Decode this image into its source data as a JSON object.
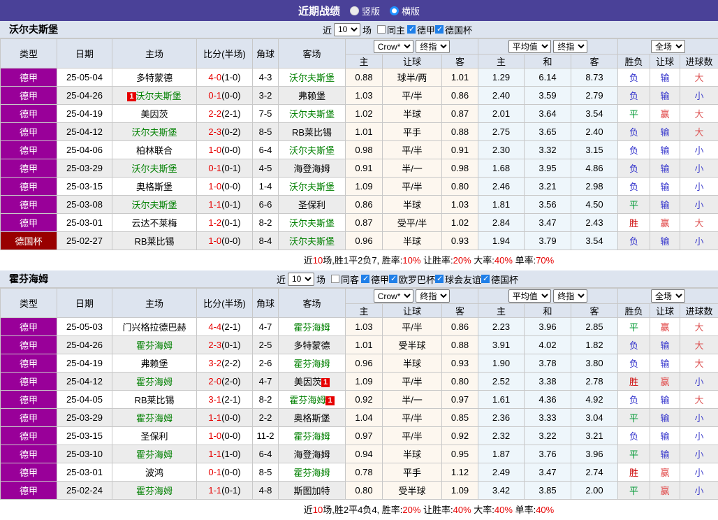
{
  "header": {
    "title": "近期战绩",
    "radio_vertical": "竖版",
    "radio_horizontal": "横版"
  },
  "table_head": {
    "type": "类型",
    "date": "日期",
    "home": "主场",
    "score": "比分(半场)",
    "corner": "角球",
    "away": "客场",
    "odds_select1": "Crow*",
    "odds_select2": "终指",
    "odds_cols": [
      "主",
      "让球",
      "客"
    ],
    "avg_select1": "平均值",
    "avg_select2": "终指",
    "avg_cols": [
      "主",
      "和",
      "客"
    ],
    "full_select": "全场",
    "full_cols": [
      "胜负",
      "让球",
      "进球数"
    ]
  },
  "colors": {
    "topbar": "#4a4198",
    "competition": {
      "德甲": "#990099",
      "德国杯": "#990000"
    },
    "highlight_team": "#008000",
    "score": "#e60000",
    "badge_bg": "#e60000",
    "values": {
      "胜": "#cc0000",
      "赢": "#e04444",
      "大": "#dd5555",
      "平": "#009933",
      "负": "#3333cc",
      "输": "#3333cc",
      "小": "#4444cc"
    }
  },
  "sections": [
    {
      "team": "沃尔夫斯堡",
      "filter": {
        "near": "近",
        "count": "10",
        "games": "场",
        "same": {
          "label": "同主",
          "checked": false
        },
        "leagues": [
          {
            "label": "德甲",
            "checked": true
          },
          {
            "label": "德国杯",
            "checked": true
          }
        ]
      },
      "rows": [
        {
          "competition": "德甲",
          "date": "25-05-04",
          "home": {
            "name": "多特蒙德"
          },
          "score": "4-0",
          "half": "(1-0)",
          "corner": "4-3",
          "away": {
            "name": "沃尔夫斯堡",
            "hl": true
          },
          "odds": [
            "0.88",
            "球半/两",
            "1.01"
          ],
          "avg": [
            "1.29",
            "6.14",
            "8.73"
          ],
          "result": [
            "负",
            "输",
            "大"
          ]
        },
        {
          "competition": "德甲",
          "date": "25-04-26",
          "home": {
            "name": "沃尔夫斯堡",
            "hl": true,
            "badge_before": "1"
          },
          "score": "0-1",
          "half": "(0-0)",
          "corner": "3-2",
          "away": {
            "name": "弗赖堡"
          },
          "odds": [
            "1.03",
            "平/半",
            "0.86"
          ],
          "avg": [
            "2.40",
            "3.59",
            "2.79"
          ],
          "result": [
            "负",
            "输",
            "小"
          ]
        },
        {
          "competition": "德甲",
          "date": "25-04-19",
          "home": {
            "name": "美因茨"
          },
          "score": "2-2",
          "half": "(2-1)",
          "corner": "7-5",
          "away": {
            "name": "沃尔夫斯堡",
            "hl": true
          },
          "odds": [
            "1.02",
            "半球",
            "0.87"
          ],
          "avg": [
            "2.01",
            "3.64",
            "3.54"
          ],
          "result": [
            "平",
            "赢",
            "大"
          ]
        },
        {
          "competition": "德甲",
          "date": "25-04-12",
          "home": {
            "name": "沃尔夫斯堡",
            "hl": true
          },
          "score": "2-3",
          "half": "(0-2)",
          "corner": "8-5",
          "away": {
            "name": "RB莱比锡"
          },
          "odds": [
            "1.01",
            "平手",
            "0.88"
          ],
          "avg": [
            "2.75",
            "3.65",
            "2.40"
          ],
          "result": [
            "负",
            "输",
            "大"
          ]
        },
        {
          "competition": "德甲",
          "date": "25-04-06",
          "home": {
            "name": "柏林联合"
          },
          "score": "1-0",
          "half": "(0-0)",
          "corner": "6-4",
          "away": {
            "name": "沃尔夫斯堡",
            "hl": true
          },
          "odds": [
            "0.98",
            "平/半",
            "0.91"
          ],
          "avg": [
            "2.30",
            "3.32",
            "3.15"
          ],
          "result": [
            "负",
            "输",
            "小"
          ]
        },
        {
          "competition": "德甲",
          "date": "25-03-29",
          "home": {
            "name": "沃尔夫斯堡",
            "hl": true
          },
          "score": "0-1",
          "half": "(0-1)",
          "corner": "4-5",
          "away": {
            "name": "海登海姆"
          },
          "odds": [
            "0.91",
            "半/一",
            "0.98"
          ],
          "avg": [
            "1.68",
            "3.95",
            "4.86"
          ],
          "result": [
            "负",
            "输",
            "小"
          ]
        },
        {
          "competition": "德甲",
          "date": "25-03-15",
          "home": {
            "name": "奥格斯堡"
          },
          "score": "1-0",
          "half": "(0-0)",
          "corner": "1-4",
          "away": {
            "name": "沃尔夫斯堡",
            "hl": true
          },
          "odds": [
            "1.09",
            "平/半",
            "0.80"
          ],
          "avg": [
            "2.46",
            "3.21",
            "2.98"
          ],
          "result": [
            "负",
            "输",
            "小"
          ]
        },
        {
          "competition": "德甲",
          "date": "25-03-08",
          "home": {
            "name": "沃尔夫斯堡",
            "hl": true
          },
          "score": "1-1",
          "half": "(0-1)",
          "corner": "6-6",
          "away": {
            "name": "圣保利"
          },
          "odds": [
            "0.86",
            "半球",
            "1.03"
          ],
          "avg": [
            "1.81",
            "3.56",
            "4.50"
          ],
          "result": [
            "平",
            "输",
            "小"
          ]
        },
        {
          "competition": "德甲",
          "date": "25-03-01",
          "home": {
            "name": "云达不莱梅"
          },
          "score": "1-2",
          "half": "(0-1)",
          "corner": "8-2",
          "away": {
            "name": "沃尔夫斯堡",
            "hl": true
          },
          "odds": [
            "0.87",
            "受平/半",
            "1.02"
          ],
          "avg": [
            "2.84",
            "3.47",
            "2.43"
          ],
          "result": [
            "胜",
            "赢",
            "大"
          ]
        },
        {
          "competition": "德国杯",
          "date": "25-02-27",
          "home": {
            "name": "RB莱比锡"
          },
          "score": "1-0",
          "half": "(0-0)",
          "corner": "8-4",
          "away": {
            "name": "沃尔夫斯堡",
            "hl": true
          },
          "odds": [
            "0.96",
            "半球",
            "0.93"
          ],
          "avg": [
            "1.94",
            "3.79",
            "3.54"
          ],
          "result": [
            "负",
            "输",
            "小"
          ]
        }
      ],
      "summary": [
        {
          "t": "近",
          "red": false
        },
        {
          "t": "10",
          "red": true
        },
        {
          "t": "场,胜1平2负7, 胜率:",
          "red": false
        },
        {
          "t": "10%",
          "red": true
        },
        {
          "t": " 让胜率:",
          "red": false
        },
        {
          "t": "20%",
          "red": true
        },
        {
          "t": " 大率:",
          "red": false
        },
        {
          "t": "40%",
          "red": true
        },
        {
          "t": " 单率:",
          "red": false
        },
        {
          "t": "70%",
          "red": true
        }
      ]
    },
    {
      "team": "霍芬海姆",
      "filter": {
        "near": "近",
        "count": "10",
        "games": "场",
        "same": {
          "label": "同客",
          "checked": false
        },
        "leagues": [
          {
            "label": "德甲",
            "checked": true
          },
          {
            "label": "欧罗巴杯",
            "checked": true
          },
          {
            "label": "球会友谊",
            "checked": true
          },
          {
            "label": "德国杯",
            "checked": true
          }
        ]
      },
      "rows": [
        {
          "competition": "德甲",
          "date": "25-05-03",
          "home": {
            "name": "门兴格拉德巴赫"
          },
          "score": "4-4",
          "half": "(2-1)",
          "corner": "4-7",
          "away": {
            "name": "霍芬海姆",
            "hl": true
          },
          "odds": [
            "1.03",
            "平/半",
            "0.86"
          ],
          "avg": [
            "2.23",
            "3.96",
            "2.85"
          ],
          "result": [
            "平",
            "赢",
            "大"
          ]
        },
        {
          "competition": "德甲",
          "date": "25-04-26",
          "home": {
            "name": "霍芬海姆",
            "hl": true
          },
          "score": "2-3",
          "half": "(0-1)",
          "corner": "2-5",
          "away": {
            "name": "多特蒙德"
          },
          "odds": [
            "1.01",
            "受半球",
            "0.88"
          ],
          "avg": [
            "3.91",
            "4.02",
            "1.82"
          ],
          "result": [
            "负",
            "输",
            "大"
          ]
        },
        {
          "competition": "德甲",
          "date": "25-04-19",
          "home": {
            "name": "弗赖堡"
          },
          "score": "3-2",
          "half": "(2-2)",
          "corner": "2-6",
          "away": {
            "name": "霍芬海姆",
            "hl": true
          },
          "odds": [
            "0.96",
            "半球",
            "0.93"
          ],
          "avg": [
            "1.90",
            "3.78",
            "3.80"
          ],
          "result": [
            "负",
            "输",
            "大"
          ]
        },
        {
          "competition": "德甲",
          "date": "25-04-12",
          "home": {
            "name": "霍芬海姆",
            "hl": true
          },
          "score": "2-0",
          "half": "(2-0)",
          "corner": "4-7",
          "away": {
            "name": "美因茨",
            "badge_after": "1"
          },
          "odds": [
            "1.09",
            "平/半",
            "0.80"
          ],
          "avg": [
            "2.52",
            "3.38",
            "2.78"
          ],
          "result": [
            "胜",
            "赢",
            "小"
          ]
        },
        {
          "competition": "德甲",
          "date": "25-04-05",
          "home": {
            "name": "RB莱比锡"
          },
          "score": "3-1",
          "half": "(2-1)",
          "corner": "8-2",
          "away": {
            "name": "霍芬海姆",
            "hl": true,
            "badge_after": "1"
          },
          "odds": [
            "0.92",
            "半/一",
            "0.97"
          ],
          "avg": [
            "1.61",
            "4.36",
            "4.92"
          ],
          "result": [
            "负",
            "输",
            "大"
          ]
        },
        {
          "competition": "德甲",
          "date": "25-03-29",
          "home": {
            "name": "霍芬海姆",
            "hl": true
          },
          "score": "1-1",
          "half": "(0-0)",
          "corner": "2-2",
          "away": {
            "name": "奥格斯堡"
          },
          "odds": [
            "1.04",
            "平/半",
            "0.85"
          ],
          "avg": [
            "2.36",
            "3.33",
            "3.04"
          ],
          "result": [
            "平",
            "输",
            "小"
          ]
        },
        {
          "competition": "德甲",
          "date": "25-03-15",
          "home": {
            "name": "圣保利"
          },
          "score": "1-0",
          "half": "(0-0)",
          "corner": "11-2",
          "away": {
            "name": "霍芬海姆",
            "hl": true
          },
          "odds": [
            "0.97",
            "平/半",
            "0.92"
          ],
          "avg": [
            "2.32",
            "3.22",
            "3.21"
          ],
          "result": [
            "负",
            "输",
            "小"
          ]
        },
        {
          "competition": "德甲",
          "date": "25-03-10",
          "home": {
            "name": "霍芬海姆",
            "hl": true
          },
          "score": "1-1",
          "half": "(1-0)",
          "corner": "6-4",
          "away": {
            "name": "海登海姆"
          },
          "odds": [
            "0.94",
            "半球",
            "0.95"
          ],
          "avg": [
            "1.87",
            "3.76",
            "3.96"
          ],
          "result": [
            "平",
            "输",
            "小"
          ]
        },
        {
          "competition": "德甲",
          "date": "25-03-01",
          "home": {
            "name": "波鸿"
          },
          "score": "0-1",
          "half": "(0-0)",
          "corner": "8-5",
          "away": {
            "name": "霍芬海姆",
            "hl": true
          },
          "odds": [
            "0.78",
            "平手",
            "1.12"
          ],
          "avg": [
            "2.49",
            "3.47",
            "2.74"
          ],
          "result": [
            "胜",
            "赢",
            "小"
          ]
        },
        {
          "competition": "德甲",
          "date": "25-02-24",
          "home": {
            "name": "霍芬海姆",
            "hl": true
          },
          "score": "1-1",
          "half": "(0-1)",
          "corner": "4-8",
          "away": {
            "name": "斯图加特"
          },
          "odds": [
            "0.80",
            "受半球",
            "1.09"
          ],
          "avg": [
            "3.42",
            "3.85",
            "2.00"
          ],
          "result": [
            "平",
            "赢",
            "小"
          ]
        }
      ],
      "summary": [
        {
          "t": "近",
          "red": false
        },
        {
          "t": "10",
          "red": true
        },
        {
          "t": "场,胜2平4负4, 胜率:",
          "red": false
        },
        {
          "t": "20%",
          "red": true
        },
        {
          "t": " 让胜率:",
          "red": false
        },
        {
          "t": "40%",
          "red": true
        },
        {
          "t": " 大率:",
          "red": false
        },
        {
          "t": "40%",
          "red": true
        },
        {
          "t": " 单率:",
          "red": false
        },
        {
          "t": "40%",
          "red": true
        }
      ]
    }
  ]
}
